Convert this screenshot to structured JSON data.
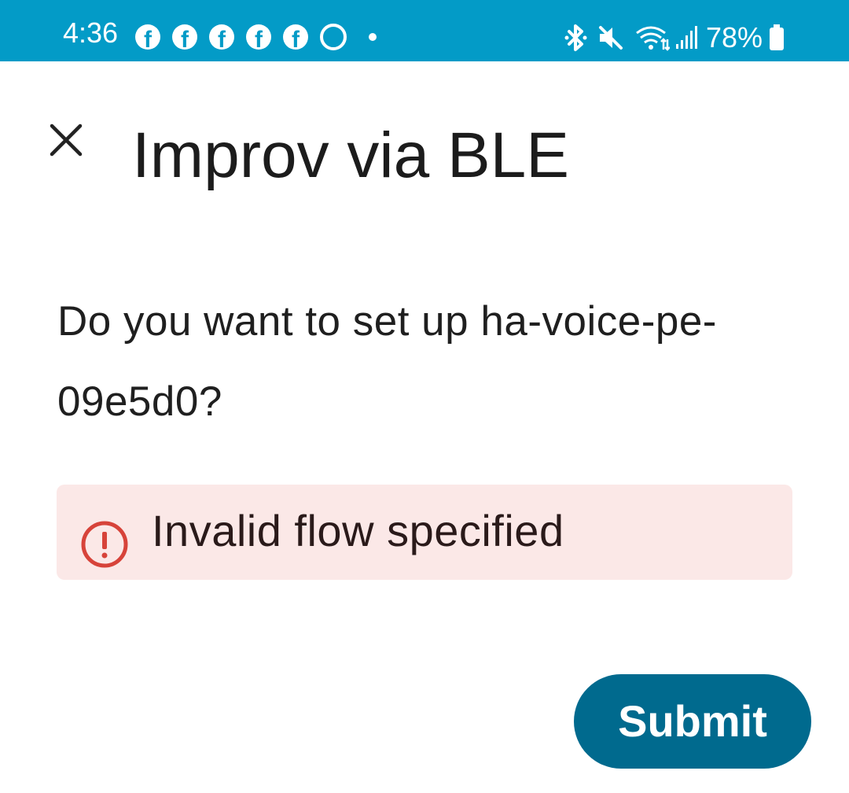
{
  "status_bar": {
    "time": "4:36",
    "battery_percent": "78%",
    "notification_icons": [
      "facebook-icon",
      "facebook-icon",
      "facebook-icon",
      "facebook-icon",
      "facebook-icon",
      "ring-icon",
      "dot-icon"
    ],
    "system_icons": [
      "bluetooth-icon",
      "mute-icon",
      "wifi-icon",
      "signal-icon",
      "battery-icon"
    ],
    "background_color": "#039bc7"
  },
  "dialog": {
    "title": "Improv via BLE",
    "close_icon": "close-icon",
    "message": "Do you want to set up ha-voice-pe-09e5d0?",
    "error": {
      "icon": "error-icon",
      "text": "Invalid flow specified",
      "background_color": "#fbe8e7",
      "icon_color": "#d7433a"
    },
    "submit_label": "Submit",
    "submit_color": "#006a8e"
  }
}
